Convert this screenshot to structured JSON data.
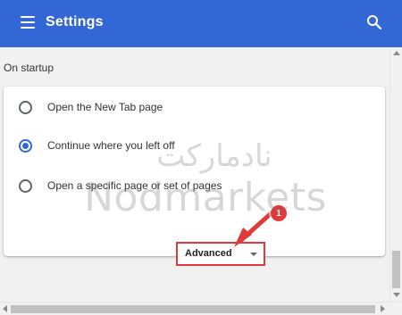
{
  "header": {
    "title": "Settings",
    "menu_icon": "hamburger-menu-icon",
    "search_icon": "search-icon",
    "color": "#3367d6"
  },
  "startup": {
    "section_title": "On startup",
    "options": [
      {
        "label": "Open the New Tab page",
        "selected": false
      },
      {
        "label": "Continue where you left off",
        "selected": true
      },
      {
        "label": "Open a specific page or set of pages",
        "selected": false
      }
    ]
  },
  "advanced": {
    "label": "Advanced",
    "icon": "caret-down-icon",
    "highlight_color": "#e03b3b"
  },
  "annotation": {
    "badge_number": "1",
    "arrow_icon": "pointer-arrow-icon"
  },
  "watermark": {
    "persian": "نادمارکت",
    "latin": "Nodmarkets"
  }
}
